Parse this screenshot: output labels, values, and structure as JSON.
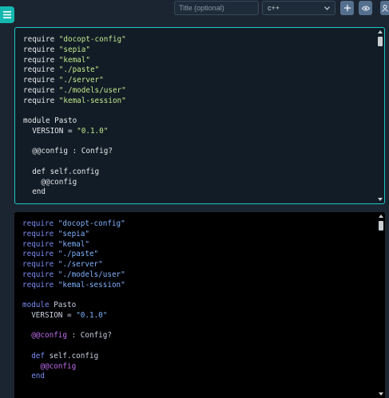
{
  "toolbar": {
    "title_placeholder": "Title (optional)",
    "language_selected": "c++",
    "menu_icon": "hamburger-icon",
    "add_icon": "plus-icon",
    "view_icon": "eye-icon",
    "user_icon": "user-icon"
  },
  "editor": {
    "lines": [
      {
        "kw": "require ",
        "str": "\"docopt-config\""
      },
      {
        "kw": "require ",
        "str": "\"sepia\""
      },
      {
        "kw": "require ",
        "str": "\"kemal\""
      },
      {
        "kw": "require ",
        "str": "\"./paste\""
      },
      {
        "kw": "require ",
        "str": "\"./server\""
      },
      {
        "kw": "require ",
        "str": "\"./models/user\""
      },
      {
        "kw": "require ",
        "str": "\"kemal-session\""
      },
      {
        "text": ""
      },
      {
        "text": "module Pasto"
      },
      {
        "kw": "  VERSION = ",
        "str": "\"0.1.0\""
      },
      {
        "text": ""
      },
      {
        "text": "  @@config : Config?"
      },
      {
        "text": ""
      },
      {
        "text": "  def self.config"
      },
      {
        "text": "    @@config"
      },
      {
        "text": "  end"
      }
    ]
  },
  "preview": {
    "lines": [
      {
        "kw": "require ",
        "str": "\"docopt-config\""
      },
      {
        "kw": "require ",
        "str": "\"sepia\""
      },
      {
        "kw": "require ",
        "str": "\"kemal\""
      },
      {
        "kw": "require ",
        "str": "\"./paste\""
      },
      {
        "kw": "require ",
        "str": "\"./server\""
      },
      {
        "kw": "require ",
        "str": "\"./models/user\""
      },
      {
        "kw": "require ",
        "str": "\"kemal-session\""
      },
      {
        "text": ""
      },
      {
        "kw": "module ",
        "plain": "Pasto"
      },
      {
        "kw": "  ",
        "plain": "VERSION = ",
        "str": "\"0.1.0\""
      },
      {
        "text": ""
      },
      {
        "kw": "  ",
        "iv": "@@config",
        "plain": " : Config?"
      },
      {
        "text": ""
      },
      {
        "kw": "  def ",
        "plain": "self.config"
      },
      {
        "kw": "    ",
        "iv": "@@config"
      },
      {
        "kw": "  end"
      }
    ]
  },
  "colors": {
    "accent": "#14b8b0",
    "editor_border": "#1ec8c4",
    "button": "#55708e",
    "background": "#1b2531"
  }
}
